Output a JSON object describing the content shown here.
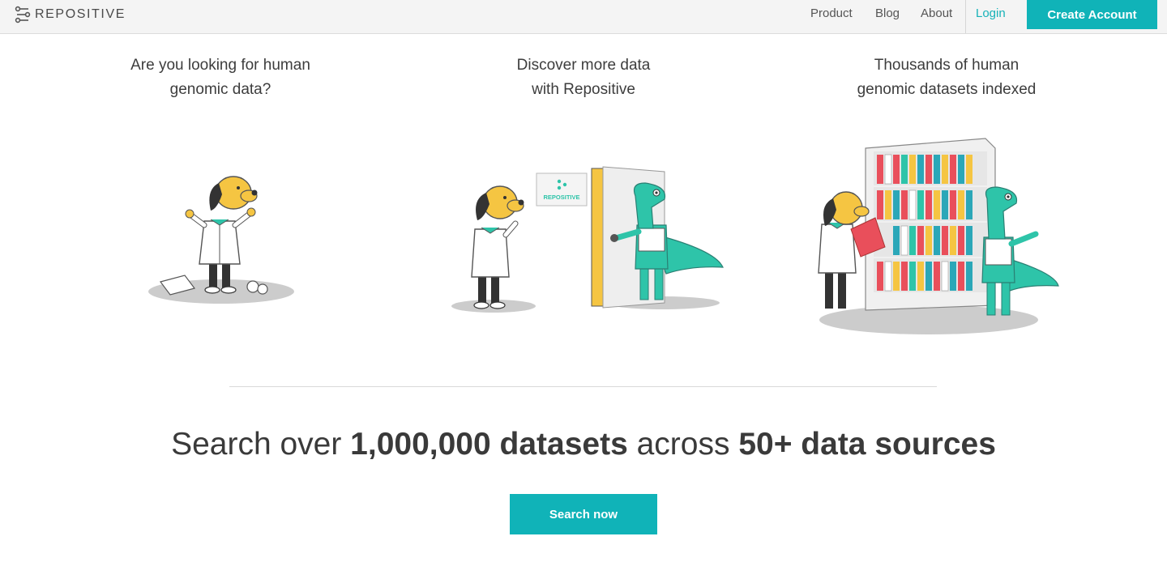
{
  "brand": {
    "name": "REPOSITIVE",
    "accent": "#10b3b8"
  },
  "nav": {
    "items": [
      {
        "label": "Product"
      },
      {
        "label": "Blog"
      },
      {
        "label": "About"
      }
    ],
    "login": "Login",
    "create_account": "Create Account"
  },
  "columns": [
    {
      "title_line1": "Are you looking for human",
      "title_line2": "genomic data?",
      "illustration": "dog-confused-icon"
    },
    {
      "title_line1": "Discover more data",
      "title_line2": "with Repositive",
      "illustration": "dog-door-dino-icon",
      "sign_text": "REPOSITIVE"
    },
    {
      "title_line1": "Thousands of human",
      "title_line2": "genomic datasets indexed",
      "illustration": "bookshelf-icon"
    }
  ],
  "headline": {
    "part1": "Search over ",
    "bold1": "1,000,000 datasets",
    "part2": " across ",
    "bold2": "50+ data sources"
  },
  "cta": {
    "search_label": "Search now"
  }
}
